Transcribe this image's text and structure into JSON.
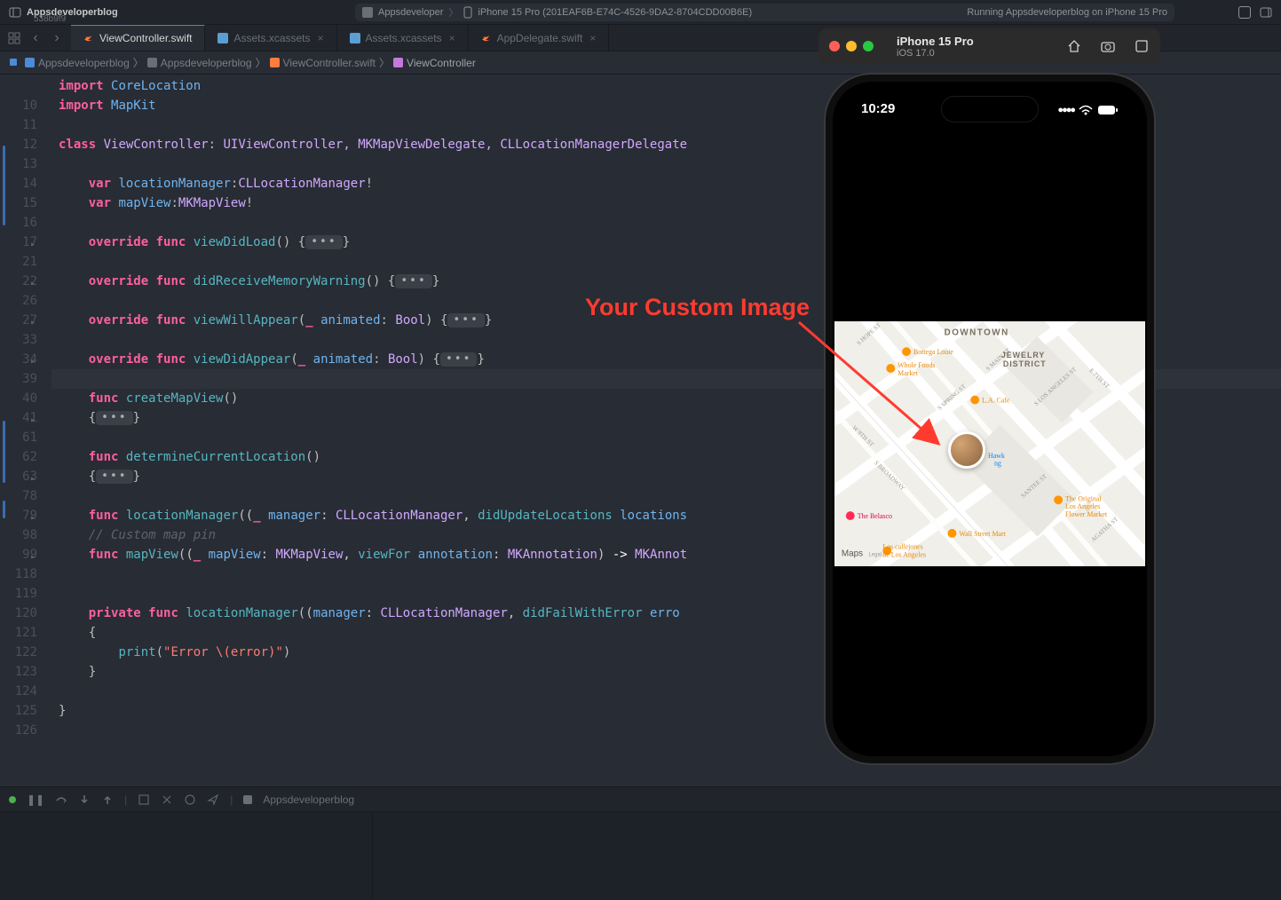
{
  "titlebar": {
    "project": "Appsdeveloperblog",
    "sha": "538b9f9",
    "center_left": "Appsdeveloper",
    "device_icon_label": "iPhone 15 Pro (201EAF6B-E74C-4526-9DA2-8704CDD00B6E)",
    "status": "Running Appsdeveloperblog on iPhone 15 Pro"
  },
  "tabs": [
    {
      "name": "ViewController.swift",
      "active": true,
      "icon": "swift"
    },
    {
      "name": "Assets.xcassets",
      "active": false,
      "icon": "assets"
    },
    {
      "name": "Assets.xcassets",
      "active": false,
      "icon": "assets"
    },
    {
      "name": "AppDelegate.swift",
      "active": false,
      "icon": "swift"
    }
  ],
  "breadcrumb": [
    {
      "label": "Appsdeveloperblog",
      "icon": "app"
    },
    {
      "label": "Appsdeveloperblog",
      "icon": "folder"
    },
    {
      "label": "ViewController.swift",
      "icon": "swift"
    },
    {
      "label": "ViewController",
      "icon": "class"
    }
  ],
  "lines": [
    {
      "n": "",
      "t": "partial",
      "prefix": "import ",
      "ident": "CoreLocation"
    },
    {
      "n": "10",
      "t": "import",
      "ident": "MapKit"
    },
    {
      "n": "11",
      "t": "blank"
    },
    {
      "n": "12",
      "t": "class",
      "name": "ViewController",
      "inherits": "UIViewController, MKMapViewDelegate, CLLocationManagerDelegate"
    },
    {
      "n": "13",
      "t": "blank"
    },
    {
      "n": "14",
      "t": "var",
      "name": "locationManager",
      "type": "CLLocationManager",
      "force": true
    },
    {
      "n": "15",
      "t": "var",
      "name": "mapView",
      "type": "MKMapView",
      "force": true
    },
    {
      "n": "16",
      "t": "blank"
    },
    {
      "n": "17",
      "t": "override_func",
      "fold": true,
      "name": "viewDidLoad",
      "sig": "()",
      "body_ellipsis": true
    },
    {
      "n": "21",
      "t": "blank"
    },
    {
      "n": "22",
      "t": "override_func",
      "fold": true,
      "name": "didReceiveMemoryWarning",
      "sig": "()",
      "body_ellipsis": true
    },
    {
      "n": "26",
      "t": "blank"
    },
    {
      "n": "27",
      "t": "override_func",
      "fold": true,
      "name": "viewWillAppear",
      "sig": "(_ animated: Bool)",
      "body_ellipsis": true
    },
    {
      "n": "33",
      "t": "blank"
    },
    {
      "n": "34",
      "t": "override_func",
      "fold": true,
      "name": "viewDidAppear",
      "sig": "(_ animated: Bool)",
      "body_ellipsis": true
    },
    {
      "n": "39",
      "t": "blank",
      "hl": true
    },
    {
      "n": "40",
      "t": "func",
      "name": "createMapView",
      "sig": "()"
    },
    {
      "n": "41",
      "t": "brace_ellipsis",
      "fold": true
    },
    {
      "n": "61",
      "t": "blank"
    },
    {
      "n": "62",
      "t": "func",
      "name": "determineCurrentLocation",
      "sig": "()"
    },
    {
      "n": "63",
      "t": "brace_ellipsis",
      "fold": true
    },
    {
      "n": "78",
      "t": "blank"
    },
    {
      "n": "79",
      "t": "func",
      "fold": true,
      "name": "locationManager",
      "sig_raw": "(_ manager: CLLocationManager, didUpdateLocations locations"
    },
    {
      "n": "98",
      "t": "comment",
      "text": "// Custom map pin"
    },
    {
      "n": "99",
      "t": "func",
      "fold": true,
      "name": "mapView",
      "sig_raw": "(_ mapView: MKMapView, viewFor annotation: MKAnnotation) -> MKAnnot"
    },
    {
      "n": "118",
      "t": "blank"
    },
    {
      "n": "119",
      "t": "blank"
    },
    {
      "n": "120",
      "t": "private_func",
      "name": "locationManager",
      "sig_raw": "(manager: CLLocationManager, didFailWithError erro"
    },
    {
      "n": "121",
      "t": "open_brace"
    },
    {
      "n": "122",
      "t": "print",
      "arg": "\"Error \\(error)\""
    },
    {
      "n": "123",
      "t": "close_brace"
    },
    {
      "n": "124",
      "t": "blank"
    },
    {
      "n": "125",
      "t": "class_close"
    },
    {
      "n": "126",
      "t": "blank"
    }
  ],
  "utilbar": {
    "scheme": "Appsdeveloperblog"
  },
  "simulator": {
    "title": "iPhone 15 Pro",
    "subtitle": "iOS 17.0",
    "time": "10:29"
  },
  "annotation": "Your Custom Image",
  "map": {
    "logo": "Maps",
    "labels": {
      "downtown": "DOWNTOWN",
      "jewelry": "JEWELRY\nDISTRICT",
      "bottega": "Bottega Louie",
      "wholefoods": "Whole Foods\nMarket",
      "lacafe": "L.A. Cafe",
      "belasco": "The Belasco",
      "wallstreet": "Wall Street Mart",
      "original": "The Original\nLos Angeles\nFlower Market",
      "callejones": "Los callejones\nde Los Angeles",
      "hawking": "Hawk\nng",
      "st9": "W 9TH ST",
      "sbroadway": "S BROADWAY",
      "sspring": "S SPRING ST",
      "smain": "S MAIN ST",
      "losangeles": "S LOS ANGELES ST",
      "santee": "SANTEE ST",
      "agatha": "AGATHA ST",
      "hope": "S HOPE ST",
      "e7": "E 7TH ST"
    }
  }
}
